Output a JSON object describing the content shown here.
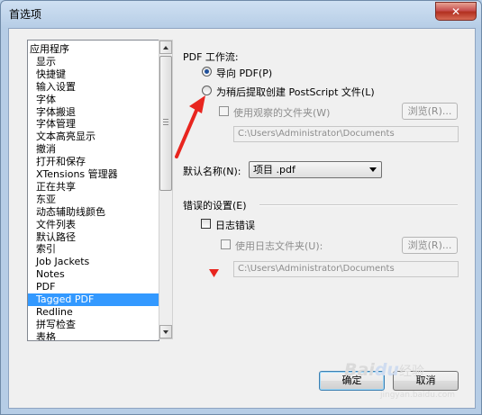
{
  "window": {
    "title": "首选项",
    "close_glyph": "✕"
  },
  "sidebar": {
    "selected_index": 20,
    "items": [
      "应用程序",
      "显示",
      "快捷键",
      "输入设置",
      "字体",
      "字体搬退",
      "字体管理",
      "文本高亮显示",
      "撤消",
      "打开和保存",
      "XTensions 管理器",
      "正在共享",
      "东亚",
      "动态辅助线颜色",
      "文件列表",
      "默认路径",
      "索引",
      "Job Jackets",
      "Notes",
      "PDF",
      "Tagged PDF",
      "Redline",
      "拼写检查",
      "表格"
    ]
  },
  "pdf_workflow": {
    "heading": "PDF 工作流:",
    "radio_direct": "导向 PDF(P)",
    "radio_postscript": "为稍后提取创建 PostScript 文件(L)",
    "check_watch_folder": "使用观察的文件夹(W)",
    "browse_label": "浏览(R)...",
    "watch_folder_path": "C:\\Users\\Administrator\\Documents"
  },
  "default_name": {
    "label": "默认名称(N):",
    "value": "项目 .pdf"
  },
  "error_settings": {
    "heading": "错误的设置(E)",
    "check_log_errors": "日志错误",
    "check_log_folder": "使用日志文件夹(U):",
    "browse_label": "浏览(R)...",
    "log_folder_path": "C:\\Users\\Administrator\\Documents"
  },
  "buttons": {
    "ok": "确定",
    "cancel": "取消"
  },
  "watermark": {
    "brand": "Bai",
    "brand_du": "du",
    "brand_suffix": "经验",
    "url": "jingyan.baidu.com"
  },
  "colors": {
    "selection": "#3399ff",
    "annotation": "#e8251f"
  }
}
